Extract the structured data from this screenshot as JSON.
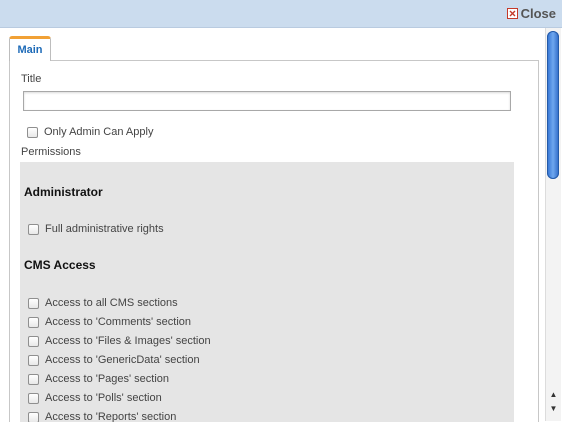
{
  "dialog": {
    "close_label": "Close"
  },
  "tabs": [
    {
      "label": "Main"
    }
  ],
  "form": {
    "title_label": "Title",
    "title_value": "",
    "title_placeholder": "",
    "only_admin_label": "Only Admin Can Apply",
    "permissions_label": "Permissions"
  },
  "permissions": {
    "groups": [
      {
        "title": "Administrator",
        "items": [
          {
            "label": "Full administrative rights"
          }
        ]
      },
      {
        "title": "CMS Access",
        "items": [
          {
            "label": "Access to all CMS sections"
          },
          {
            "label": "Access to 'Comments' section"
          },
          {
            "label": "Access to 'Files & Images' section"
          },
          {
            "label": "Access to 'GenericData' section"
          },
          {
            "label": "Access to 'Pages' section"
          },
          {
            "label": "Access to 'Polls' section"
          },
          {
            "label": "Access to 'Reports' section"
          }
        ]
      }
    ]
  },
  "colors": {
    "topbar": "#cbdcee",
    "tab_accent": "#f1a135",
    "tab_text": "#1e6bb8",
    "permissions_bg": "#e5e5e5",
    "scroll_thumb": "#3a7ad8"
  }
}
